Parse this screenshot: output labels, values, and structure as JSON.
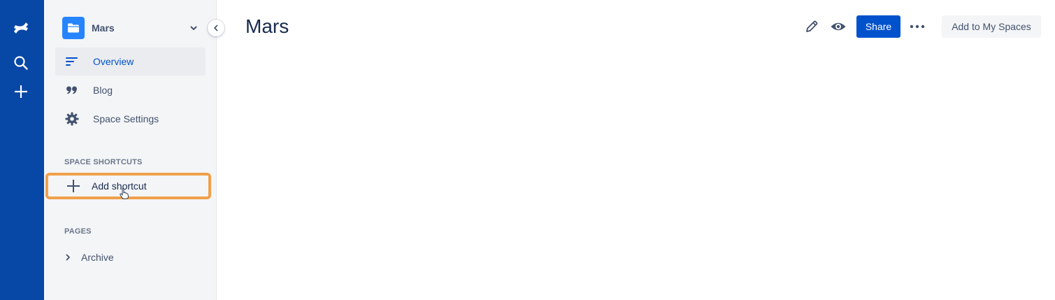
{
  "global_nav": {
    "color": "#0747a6",
    "icons": [
      "confluence-logo-icon",
      "search-icon",
      "create-plus-icon"
    ]
  },
  "space": {
    "name": "Mars",
    "avatar_icon": "folder-icon",
    "avatar_color": "#2684ff"
  },
  "sidebar": {
    "items": [
      {
        "label": "Overview",
        "icon": "overview-lines-icon",
        "selected": true
      },
      {
        "label": "Blog",
        "icon": "quote-icon",
        "selected": false
      },
      {
        "label": "Space Settings",
        "icon": "gear-icon",
        "selected": false
      }
    ],
    "shortcuts_heading": "SPACE SHORTCUTS",
    "add_shortcut_label": "Add shortcut",
    "highlight_color": "#f0a04b",
    "pages_heading": "PAGES",
    "pages": [
      {
        "label": "Archive",
        "icon": "chevron-right-icon"
      }
    ]
  },
  "main": {
    "title": "Mars"
  },
  "toolbar": {
    "share_label": "Share",
    "add_to_spaces_label": "Add to My Spaces",
    "share_color": "#0052cc",
    "icons": [
      "edit-pencil-icon",
      "watch-eye-icon",
      "more-dots-icon"
    ]
  }
}
